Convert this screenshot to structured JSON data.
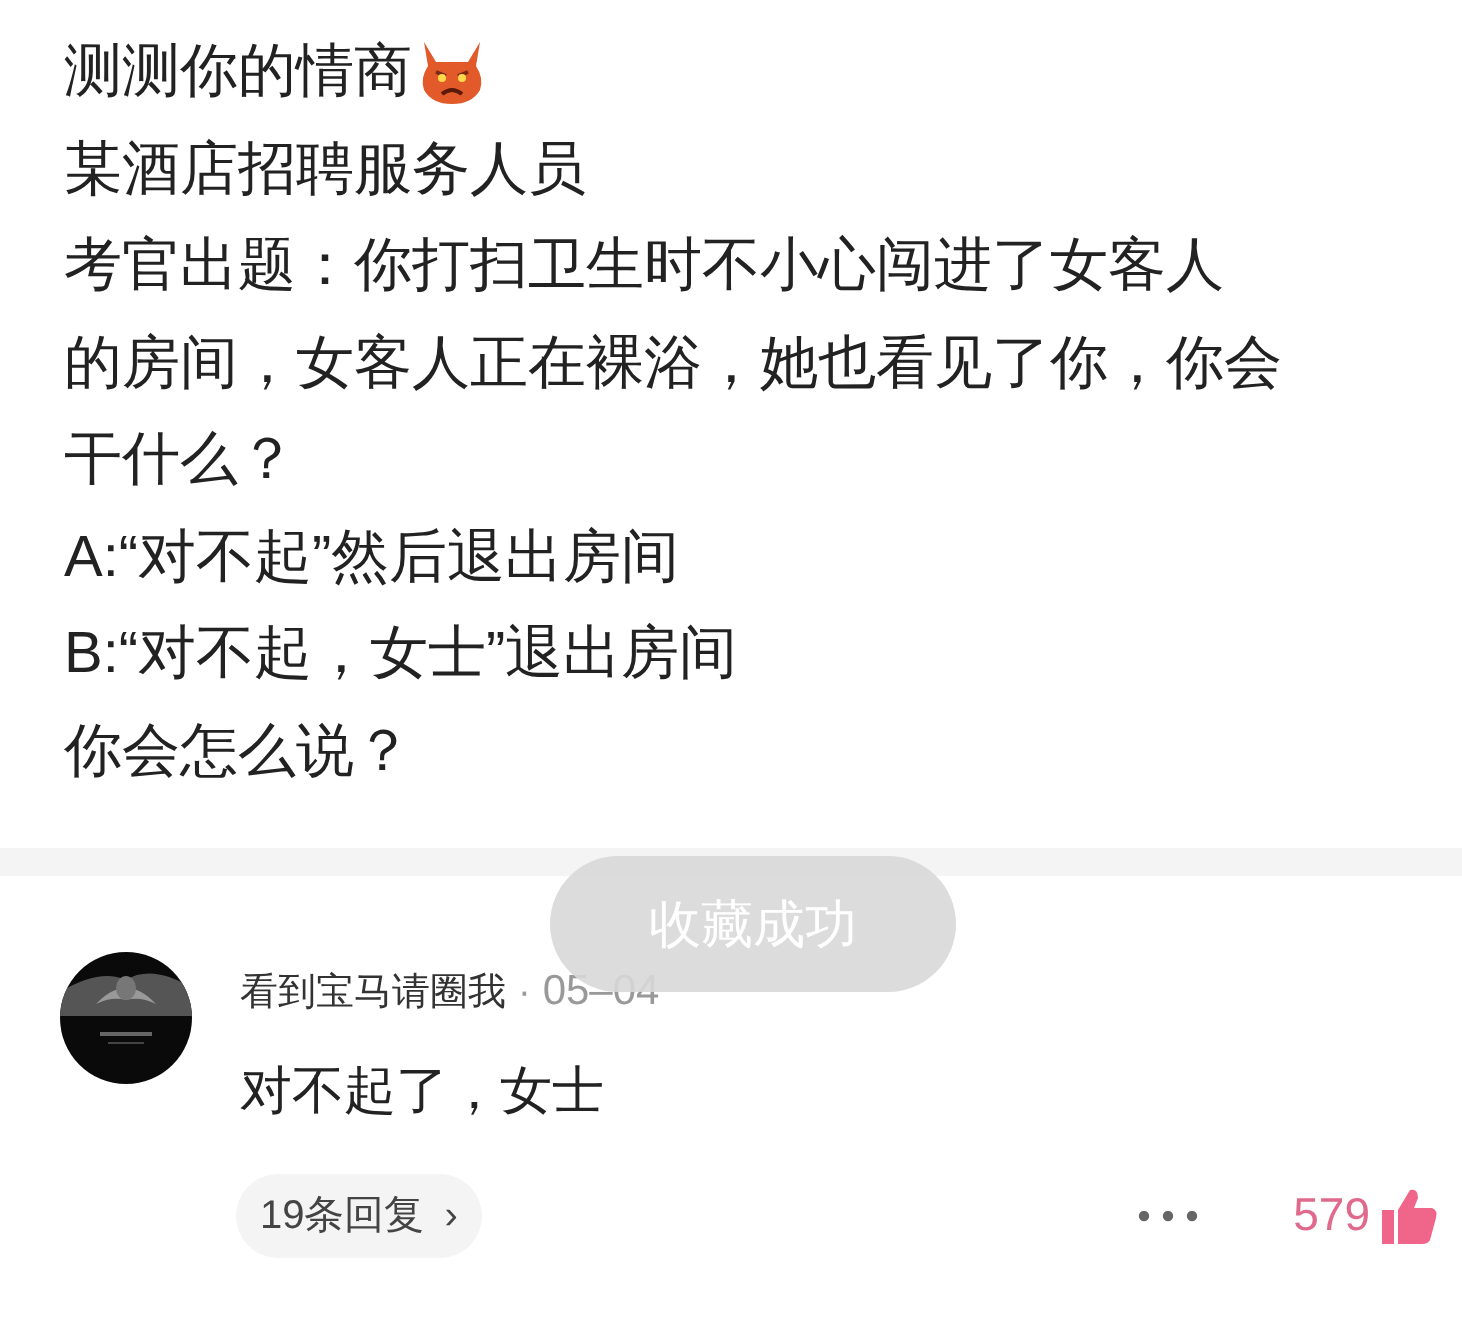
{
  "post": {
    "title": "测测你的情商",
    "lines": [
      "某酒店招聘服务人员",
      "考官出题：你打扫卫生时不小心闯进了女客人",
      "的房间，女客人正在裸浴，她也看见了你，你会",
      "干什么？",
      "A:“对不起”然后退出房间",
      "B:“对不起，女士”退出房间",
      "你会怎么说？"
    ]
  },
  "toast": {
    "text": "收藏成功"
  },
  "comment": {
    "author": "看到宝马请圈我",
    "separator": "·",
    "date": "05–04",
    "text": "对不起了，女士",
    "replies": "19条回复",
    "replies_arrow": "›",
    "likes": "579",
    "liked": true
  }
}
